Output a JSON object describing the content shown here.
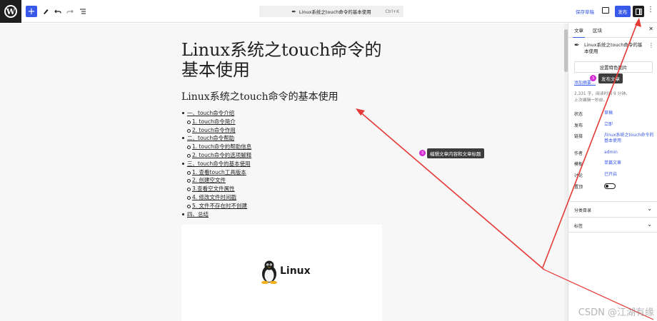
{
  "toolbar": {
    "command_title": "Linux系统之touch命令的基本使用",
    "command_shortcut": "Ctrl+K",
    "save_draft": "保存草稿",
    "publish": "发布"
  },
  "editor": {
    "post_title": "Linux系统之touch命令的基本使用",
    "heading": "Linux系统之touch命令的基本使用",
    "toc": [
      {
        "level": 1,
        "text": "一、touch命令介绍"
      },
      {
        "level": 2,
        "text": "1. touch命令简介"
      },
      {
        "level": 2,
        "text": "2. touch命令作用"
      },
      {
        "level": 1,
        "text": "二、touch命令帮助"
      },
      {
        "level": 2,
        "text": "1. touch命令的帮助信息"
      },
      {
        "level": 2,
        "text": "2. touch命令的选项解释"
      },
      {
        "level": 1,
        "text": "三、touch命令的基本使用"
      },
      {
        "level": 2,
        "text": "1. 查看touch工具版本"
      },
      {
        "level": 2,
        "text": "2. 创建空文件"
      },
      {
        "level": 2,
        "text": "3.查看空文件属性"
      },
      {
        "level": 2,
        "text": "4. 修改文件时间戳"
      },
      {
        "level": 2,
        "text": "5. 文件不存在时不创建"
      },
      {
        "level": 1,
        "text": "四、总结"
      }
    ],
    "image_caption": "Linux"
  },
  "annotations": {
    "edit_tip": "编辑文章内容和文章标题",
    "publish_tip": "发布文章",
    "badge_number": "3"
  },
  "sidebar": {
    "tabs": [
      "文章",
      "区块"
    ],
    "post_title": "Linux系统之touch命令的基本使用",
    "featured_image": "设置特色图片",
    "excerpt_link": "添加摘要…",
    "word_stats": "2,331 字，阅读时间 9 分钟。",
    "last_edited": "上次编辑一秒前。",
    "rows": [
      {
        "label": "状态",
        "value": "草稿"
      },
      {
        "label": "发布",
        "value": "立即"
      },
      {
        "label": "链接",
        "value": "/linux系统之touch命令的基本使用"
      },
      {
        "label": "作者",
        "value": "admin"
      },
      {
        "label": "模板",
        "value": "单篇文章"
      },
      {
        "label": "讨论",
        "value": "已开启"
      },
      {
        "label": "置顶",
        "value": ""
      }
    ],
    "panels": [
      "分类目录",
      "标签"
    ]
  },
  "watermark": "CSDN @江湖有缘",
  "colors": {
    "accent": "#3858e9",
    "arrow": "#e53935",
    "badge": "#d52ad5",
    "dark": "#1e1e1e"
  }
}
